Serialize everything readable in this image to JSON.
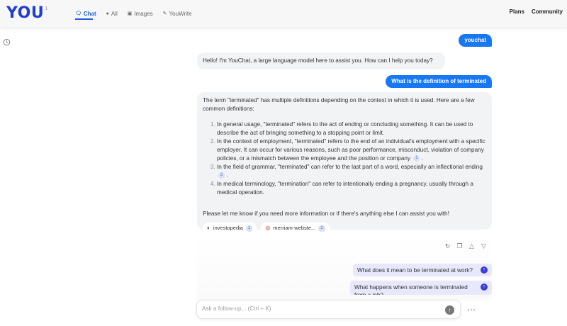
{
  "header": {
    "logo": "YOU",
    "logo_sup": "1",
    "nav": [
      {
        "label": "Chat",
        "icon": "chat-icon",
        "active": true
      },
      {
        "label": "All",
        "icon": "globe-icon",
        "active": false
      },
      {
        "label": "Images",
        "icon": "images-icon",
        "active": false
      },
      {
        "label": "YouWrite",
        "icon": "pen-icon",
        "active": false
      }
    ],
    "right_links": [
      "Plans",
      "Community"
    ]
  },
  "chat": {
    "messages": [
      {
        "role": "user",
        "text": "youchat"
      },
      {
        "role": "bot",
        "text": "Hello! I'm YouChat, a large language model here to assist you. How can I help you today?"
      },
      {
        "role": "user",
        "text": "What is the definition of terminated"
      }
    ],
    "answer": {
      "intro": "The term \"terminated\" has multiple definitions depending on the context in which it is used. Here are a few common definitions:",
      "items": [
        {
          "text": "In general usage, \"terminated\" refers to the act of ending or concluding something. It can be used to describe the act of bringing something to a stopping point or limit.",
          "cite": ""
        },
        {
          "text": "In the context of employment, \"terminated\" refers to the end of an individual's employment with a specific employer. It can occur for various reasons, such as poor performance, misconduct, violation of company policies, or a mismatch between the employee and the position or company",
          "cite": "1"
        },
        {
          "text": "In the field of grammar, \"terminated\" can refer to the last part of a word, especially an inflectional ending",
          "cite": "2"
        },
        {
          "text": "In medical terminology, \"termination\" can refer to intentionally ending a pregnancy, usually through a medical operation.",
          "cite": ""
        }
      ],
      "outro": "Please let me know if you need more information or if there's anything else I can assist you with!",
      "sources": [
        {
          "name": "investopedia",
          "num": "1"
        },
        {
          "name": "merriam-webste...",
          "num": "2"
        }
      ]
    },
    "suggestions": [
      "What does it mean to be terminated at work?",
      "What happens when someone is terminated from a job?"
    ]
  },
  "input": {
    "placeholder": "Ask a follow-up... (Ctrl + K)"
  },
  "colors": {
    "accent": "#1877f2",
    "logo": "#1f3fd0",
    "suggest_bg": "#e7e8fb"
  }
}
